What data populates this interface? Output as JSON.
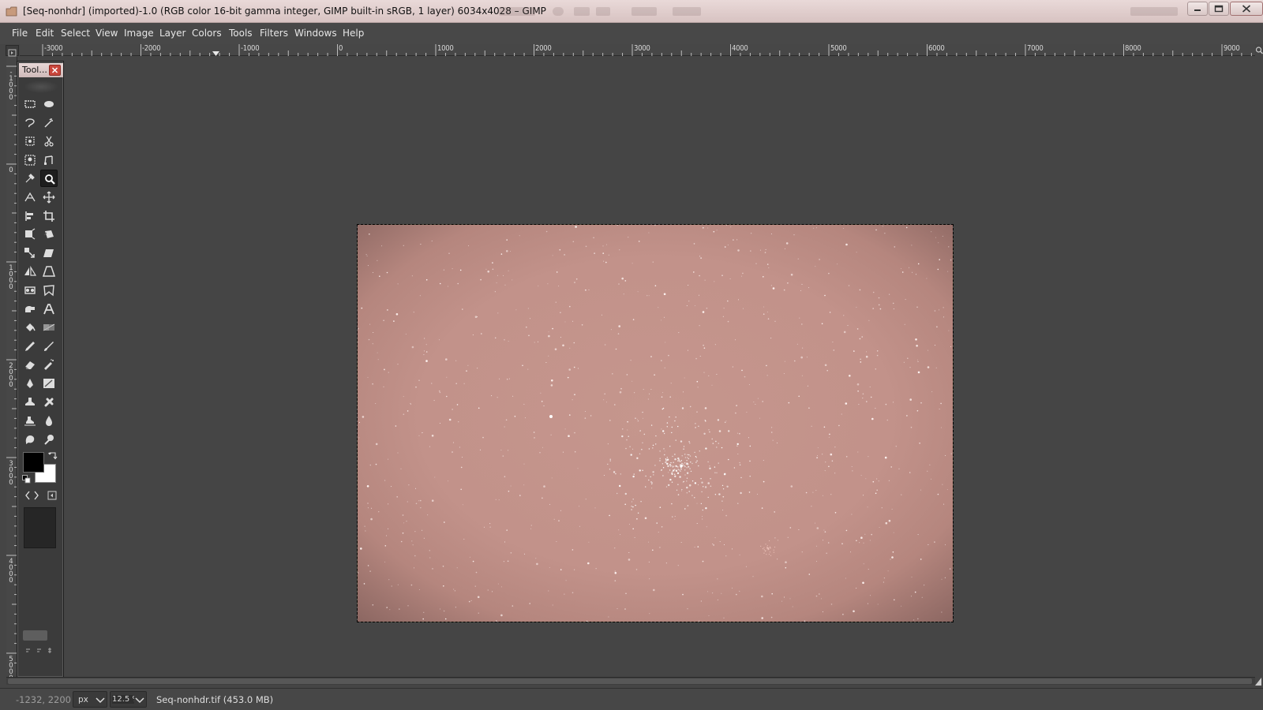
{
  "window": {
    "title": "[Seq-nonhdr] (imported)-1.0 (RGB color 16-bit gamma integer, GIMP built-in sRGB, 1 layer) 6034x4028 – GIMP",
    "app_icon": "gimp-icon",
    "controls": [
      "minimize-icon",
      "maximize-icon",
      "close-icon"
    ]
  },
  "menubar": {
    "items": [
      "File",
      "Edit",
      "Select",
      "View",
      "Image",
      "Layer",
      "Colors",
      "Tools",
      "Filters",
      "Windows",
      "Help"
    ]
  },
  "rulers": {
    "horizontal_labels": [
      "-3000",
      "-2000",
      "-1000",
      "0",
      "1000",
      "2000",
      "3000",
      "4000",
      "5000",
      "6000",
      "7000",
      "8000",
      "9000"
    ],
    "vertical_labels": [
      "-1000",
      "0",
      "1000",
      "2000",
      "3000",
      "4000",
      "5000"
    ]
  },
  "toolbox": {
    "title": "Tool...",
    "close_icon": "close-icon",
    "tools": [
      "rectangle-select-icon",
      "ellipse-select-icon",
      "free-select-icon",
      "fuzzy-select-icon",
      "select-by-color-icon",
      "scissors-select-icon",
      "foreground-select-icon",
      "paths-icon",
      "color-picker-icon",
      "zoom-icon",
      "measure-icon",
      "move-icon",
      "align-icon",
      "crop-icon",
      "unified-transform-icon",
      "rotate-icon",
      "scale-icon",
      "shear-icon",
      "flip-icon",
      "perspective-icon",
      "handle-transform-icon",
      "cage-transform-icon",
      "warp-transform-icon",
      "text-icon",
      "bucket-fill-icon",
      "gradient-icon",
      "pencil-icon",
      "paintbrush-icon",
      "eraser-icon",
      "airbrush-icon",
      "ink-icon",
      "mypaint-brush-icon",
      "clone-icon",
      "heal-icon",
      "perspective-clone-icon",
      "blur-sharpen-icon",
      "smudge-icon",
      "dodge-burn-icon"
    ],
    "active_tool": "zoom-icon",
    "foreground_color": "#000000",
    "background_color": "#ffffff"
  },
  "canvas": {
    "background_color": "#454545",
    "image_colors": [
      "#c5968d",
      "#8c6762"
    ]
  },
  "statusbar": {
    "coordinates": "-1232, 2200",
    "unit": "px",
    "zoom": "12.5 %",
    "message": "Seq-nonhdr.tif (453.0 MB)"
  }
}
